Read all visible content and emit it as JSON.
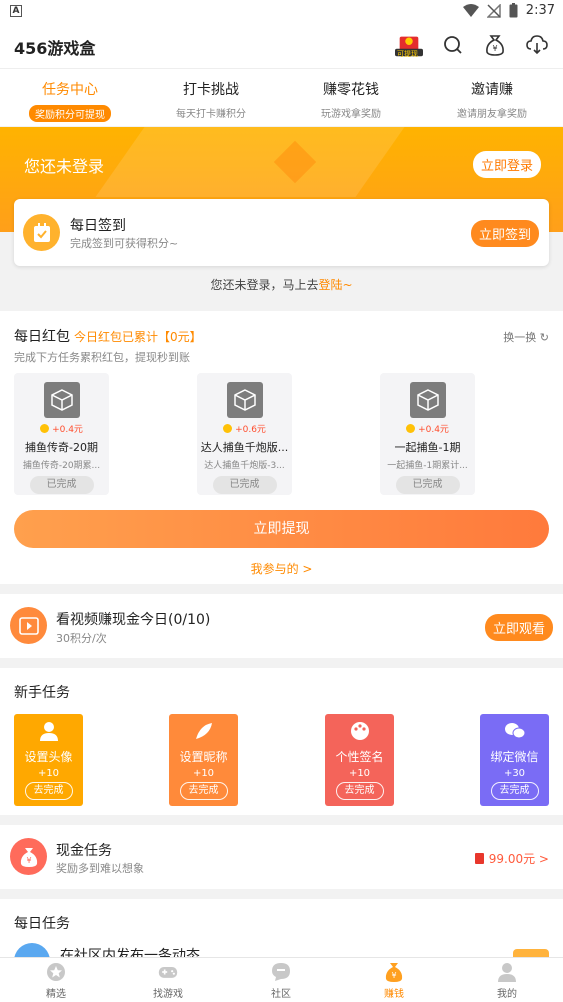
{
  "statusbar": {
    "app_indicator": "A",
    "time": "2:37"
  },
  "header": {
    "title": "456游戏盒",
    "gift_label": "可提现"
  },
  "tabs": [
    {
      "title": "任务中心",
      "subtitle": "奖励积分可提现",
      "active": true
    },
    {
      "title": "打卡挑战",
      "subtitle": "每天打卡赚积分",
      "active": false
    },
    {
      "title": "赚零花钱",
      "subtitle": "玩游戏拿奖励",
      "active": false
    },
    {
      "title": "邀请赚",
      "subtitle": "邀请朋友拿奖励",
      "active": false
    }
  ],
  "banner": {
    "not_logged": "您还未登录",
    "login_button": "立即登录"
  },
  "signin": {
    "title": "每日签到",
    "desc": "完成签到可获得积分~",
    "button": "立即签到"
  },
  "login_hint": {
    "text": "您还未登录，马上去",
    "link": "登陆~"
  },
  "redpack": {
    "title": "每日红包",
    "accumulated": "今日红包已累计【0元】",
    "swap": "换一换",
    "subtitle": "完成下方任务累积红包，提现秒到账",
    "cards": [
      {
        "amount": "+0.4元",
        "name": "捕鱼传奇-20期",
        "desc": "捕鱼传奇-20期累...",
        "status": "已完成"
      },
      {
        "amount": "+0.6元",
        "name": "达人捕鱼千炮版...",
        "desc": "达人捕鱼千炮版-3...",
        "status": "已完成"
      },
      {
        "amount": "+0.4元",
        "name": "一起捕鱼-1期",
        "desc": "一起捕鱼-1期累计...",
        "status": "已完成"
      }
    ],
    "withdraw_button": "立即提现",
    "joined_link": "我参与的 >"
  },
  "video": {
    "title": "看视频赚现金今日(0/10)",
    "desc": "30积分/次",
    "button": "立即观看"
  },
  "newbie": {
    "title": "新手任务",
    "cards": [
      {
        "title": "设置头像",
        "points": "+10",
        "button": "去完成",
        "color": "#ffa800",
        "icon": "user-icon"
      },
      {
        "title": "设置昵称",
        "points": "+10",
        "button": "去完成",
        "color": "#ff8a3a",
        "icon": "feather-icon"
      },
      {
        "title": "个性签名",
        "points": "+10",
        "button": "去完成",
        "color": "#f4645a",
        "icon": "palette-icon"
      },
      {
        "title": "绑定微信",
        "points": "+30",
        "button": "去完成",
        "color": "#7a6cf5",
        "icon": "wechat-icon"
      }
    ]
  },
  "cash": {
    "title": "现金任务",
    "desc": "奖励多到难以想象",
    "reward": "99.00元 >"
  },
  "daily": {
    "title": "每日任务",
    "first_task": "在社区内发布一条动态"
  },
  "nav": [
    {
      "label": "精选",
      "icon": "star-icon",
      "active": false
    },
    {
      "label": "找游戏",
      "icon": "gamepad-icon",
      "active": false
    },
    {
      "label": "社区",
      "icon": "chat-icon",
      "active": false
    },
    {
      "label": "赚钱",
      "icon": "moneybag-icon",
      "active": true
    },
    {
      "label": "我的",
      "icon": "profile-icon",
      "active": false
    }
  ],
  "colors": {
    "accent": "#ff8a00",
    "banner": "#ffb300"
  }
}
